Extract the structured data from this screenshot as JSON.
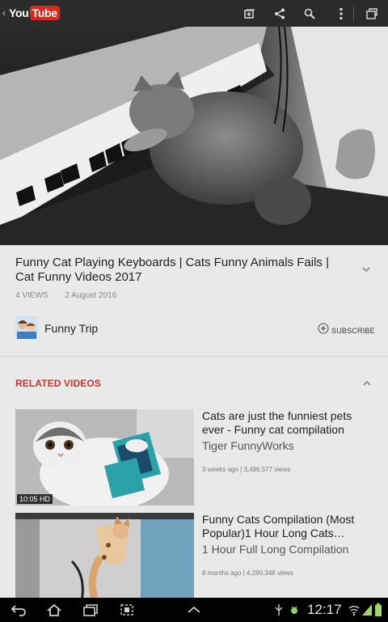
{
  "app": {
    "logo_you": "You",
    "logo_tube": "Tube",
    "icons": [
      "back-caret-icon",
      "add-to-playlist-icon",
      "share-icon",
      "search-icon",
      "overflow-menu-icon",
      "minimize-window-icon"
    ]
  },
  "video": {
    "title": "Funny Cat Playing Keyboards | Cats Funny Animals Fails | Cat Funny Videos 2017",
    "views": "4 VIEWS",
    "date": "2 August 2016",
    "channel": "Funny Trip",
    "subscribe_label": "SUBSCRIBE"
  },
  "related": {
    "header": "RELATED VIDEOS",
    "items": [
      {
        "title": "Cats are just the funniest pets ever - Funny cat compilation",
        "channel": "Tiger FunnyWorks",
        "stats": "3 weeks ago | 3,496,577 views",
        "duration": "10:05 HD"
      },
      {
        "title": "Funny Cats Compilation (Most Popular)1 Hour Long Cats…",
        "channel": "1 Hour Full Long Compilation",
        "stats": "8 months ago | 4,280,348 views",
        "duration": ""
      }
    ]
  },
  "system": {
    "clock": "12:17"
  },
  "colors": {
    "accent_red": "#c8372d",
    "youtube_red": "#d8281f",
    "topbar": "#2b2b2b",
    "background": "#e9e9e9"
  }
}
